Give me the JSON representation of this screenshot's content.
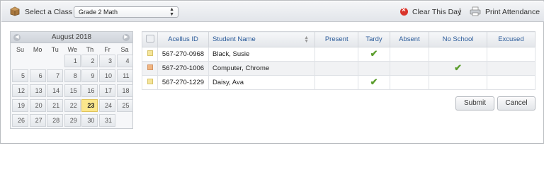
{
  "toolbar": {
    "class_label": "Select a Class",
    "class_value": "Grade 2 Math",
    "clear_label": "Clear This Day",
    "separator": "|",
    "print_label": "Print Attendance"
  },
  "calendar": {
    "title": "August 2018",
    "weekdays": [
      "Su",
      "Mo",
      "Tu",
      "We",
      "Th",
      "Fr",
      "Sa"
    ],
    "weeks": [
      [
        "",
        "",
        "",
        "1",
        "2",
        "3",
        "4"
      ],
      [
        "5",
        "6",
        "7",
        "8",
        "9",
        "10",
        "11"
      ],
      [
        "12",
        "13",
        "14",
        "15",
        "16",
        "17",
        "18"
      ],
      [
        "19",
        "20",
        "21",
        "22",
        "23",
        "24",
        "25"
      ],
      [
        "26",
        "27",
        "28",
        "29",
        "30",
        "31",
        ""
      ]
    ],
    "selected_day": "23"
  },
  "table": {
    "headers": {
      "id": "Acellus ID",
      "name": "Student Name",
      "present": "Present",
      "tardy": "Tardy",
      "absent": "Absent",
      "no_school": "No School",
      "excused": "Excused"
    },
    "rows": [
      {
        "id": "567-270-0968",
        "name": "Black, Susie",
        "status": "tardy"
      },
      {
        "id": "567-270-1006",
        "name": "Computer, Chrome",
        "status": "no_school"
      },
      {
        "id": "567-270-1229",
        "name": "Daisy, Ava",
        "status": "tardy"
      }
    ]
  },
  "buttons": {
    "submit": "Submit",
    "cancel": "Cancel"
  },
  "colors": {
    "header_text": "#2b5b9a",
    "check": "#5c9e2e",
    "today_highlight": "#fbe78c"
  }
}
